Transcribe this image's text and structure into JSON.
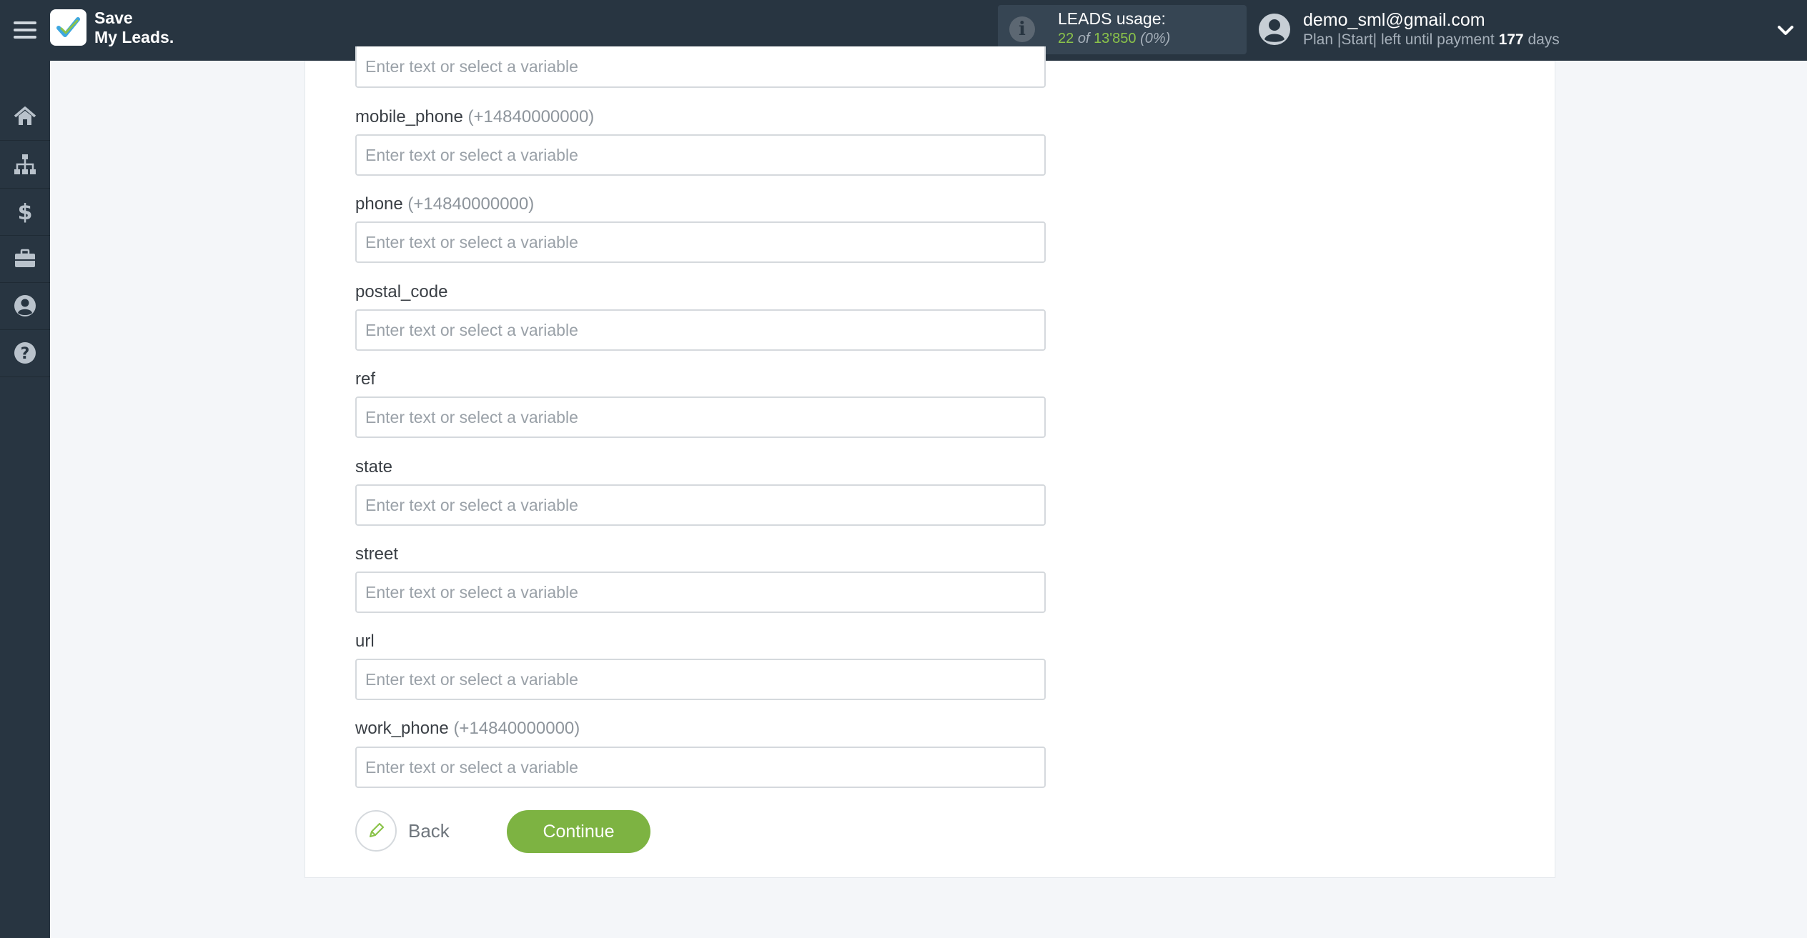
{
  "app": {
    "logo_line1": "Save",
    "logo_line2": "My Leads."
  },
  "usage": {
    "title": "LEADS usage:",
    "used": "22",
    "of": "of",
    "total": "13'850",
    "percent": "(0%)"
  },
  "user": {
    "email": "demo_sml@gmail.com",
    "plan_prefix": "Plan |Start| left until payment",
    "days": "177",
    "days_suffix": "days"
  },
  "sidebar": {
    "items": [
      {
        "icon": "home-icon"
      },
      {
        "icon": "sitemap-icon"
      },
      {
        "icon": "dollar-icon"
      },
      {
        "icon": "briefcase-icon"
      },
      {
        "icon": "user-circle-icon"
      },
      {
        "icon": "help-icon"
      }
    ]
  },
  "form": {
    "placeholder": "Enter text or select a variable",
    "fields": [
      {
        "label": "mobile_phone",
        "hint": "(+14840000000)"
      },
      {
        "label": "phone",
        "hint": "(+14840000000)"
      },
      {
        "label": "postal_code",
        "hint": ""
      },
      {
        "label": "ref",
        "hint": ""
      },
      {
        "label": "state",
        "hint": ""
      },
      {
        "label": "street",
        "hint": ""
      },
      {
        "label": "url",
        "hint": ""
      },
      {
        "label": "work_phone",
        "hint": "(+14840000000)"
      }
    ]
  },
  "actions": {
    "back_label": "Back",
    "continue_label": "Continue"
  },
  "colors": {
    "topbar": "#283541",
    "accent_green": "#7db342",
    "usage_green": "#8bc34a"
  }
}
